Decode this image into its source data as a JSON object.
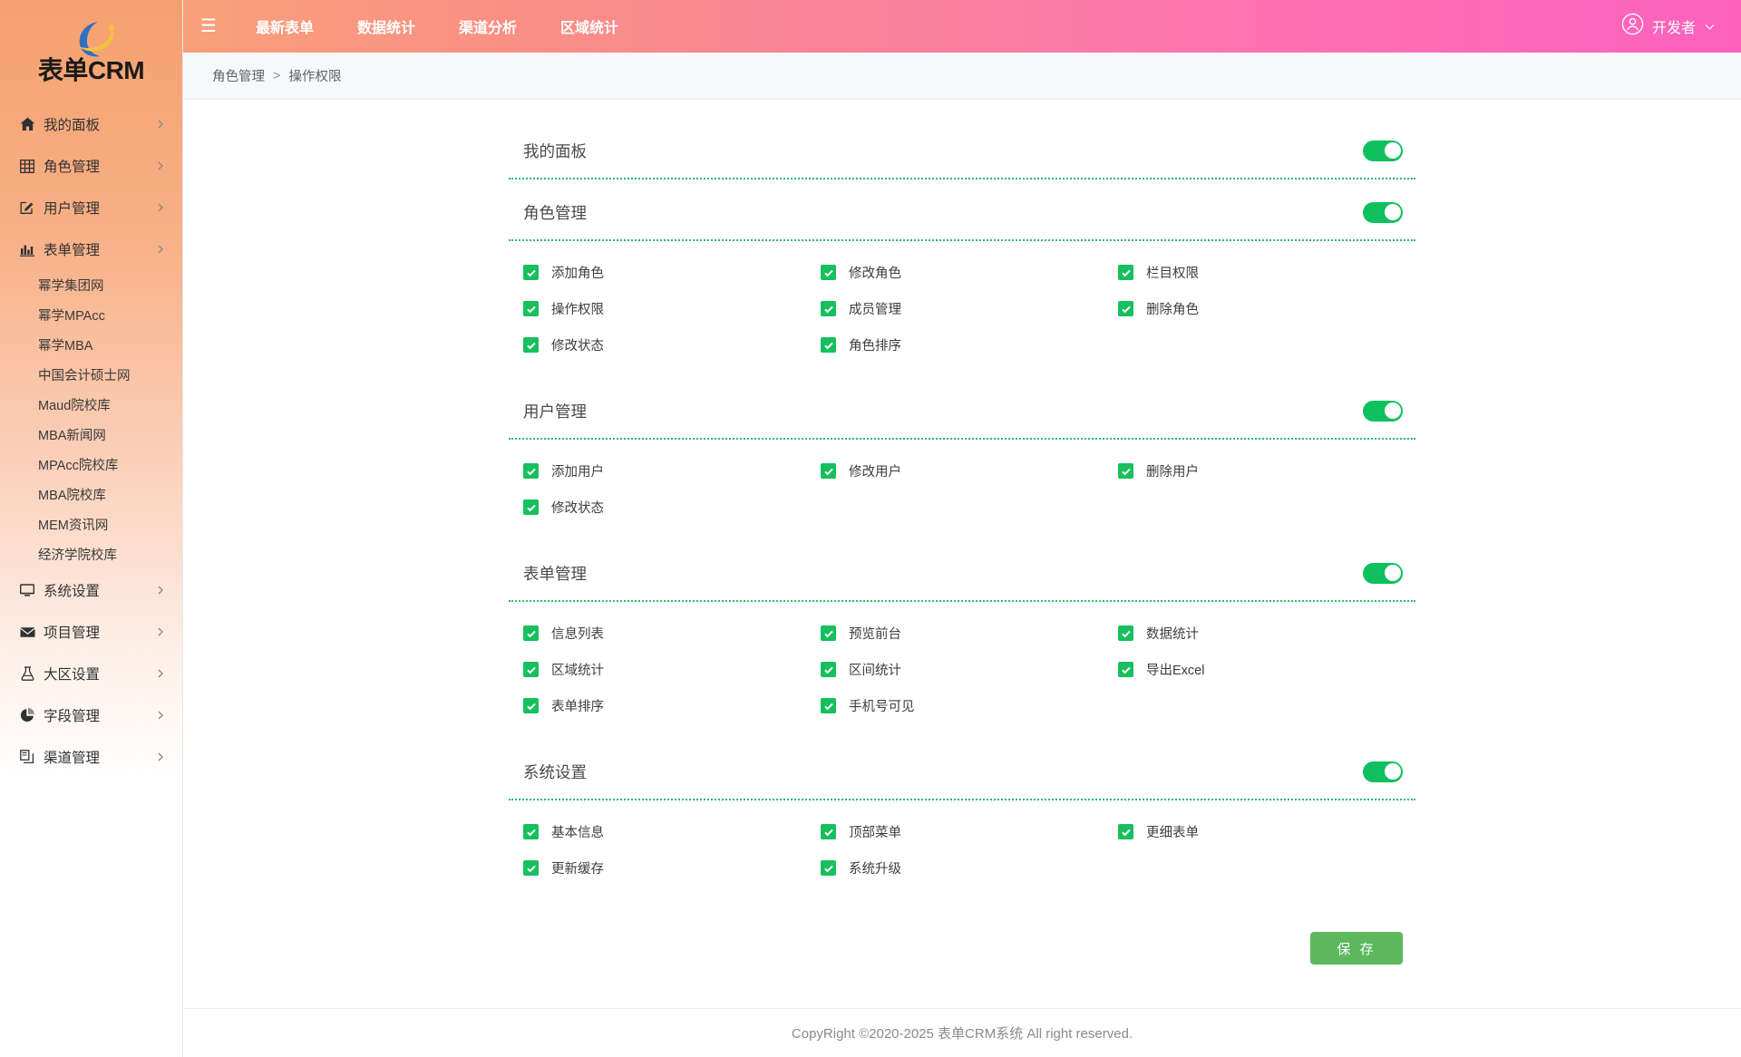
{
  "brand": {
    "name": "表单CRM",
    "logo_icon": "crescent-swoosh-logo",
    "logo_colors": {
      "crescent": "#2f6fc4",
      "swoosh": "#f5c13d"
    },
    "sidebar_gradient_from": "#f5a06e",
    "sidebar_gradient_to": "#ffffff"
  },
  "topbar": {
    "menu_toggle_icon": "hamburger-icon",
    "menu_toggle_label": "☰",
    "gradient_from": "#f8a07a",
    "gradient_to": "#fd61bd",
    "items": [
      {
        "label": "最新表单"
      },
      {
        "label": "数据统计"
      },
      {
        "label": "渠道分析"
      },
      {
        "label": "区域统计"
      }
    ],
    "user": {
      "avatar_icon": "user-circle-icon",
      "name": "开发者",
      "chevron_icon": "chevron-down-icon"
    }
  },
  "breadcrumb": {
    "parent": "角色管理",
    "separator": ">",
    "current": "操作权限"
  },
  "permissions": {
    "accent_on": "#0fc05e",
    "checkbox_color": "#18bf5e",
    "divider_color": "#2fb86b",
    "groups": [
      {
        "title": "我的面板",
        "enabled": true,
        "toggle_state": "on",
        "items": []
      },
      {
        "title": "角色管理",
        "enabled": true,
        "toggle_state": "on",
        "items": [
          {
            "label": "添加角色",
            "checked": true
          },
          {
            "label": "修改角色",
            "checked": true
          },
          {
            "label": "栏目权限",
            "checked": true
          },
          {
            "label": "操作权限",
            "checked": true
          },
          {
            "label": "成员管理",
            "checked": true
          },
          {
            "label": "删除角色",
            "checked": true
          },
          {
            "label": "修改状态",
            "checked": true
          },
          {
            "label": "角色排序",
            "checked": true
          }
        ]
      },
      {
        "title": "用户管理",
        "enabled": true,
        "toggle_state": "on",
        "items": [
          {
            "label": "添加用户",
            "checked": true
          },
          {
            "label": "修改用户",
            "checked": true
          },
          {
            "label": "删除用户",
            "checked": true
          },
          {
            "label": "修改状态",
            "checked": true
          }
        ]
      },
      {
        "title": "表单管理",
        "enabled": true,
        "toggle_state": "on",
        "items": [
          {
            "label": "信息列表",
            "checked": true
          },
          {
            "label": "预览前台",
            "checked": true
          },
          {
            "label": "数据统计",
            "checked": true
          },
          {
            "label": "区域统计",
            "checked": true
          },
          {
            "label": "区间统计",
            "checked": true
          },
          {
            "label": "导出Excel",
            "checked": true
          },
          {
            "label": "表单排序",
            "checked": true
          },
          {
            "label": "手机号可见",
            "checked": true
          }
        ]
      },
      {
        "title": "系统设置",
        "enabled": true,
        "toggle_state": "on",
        "items": [
          {
            "label": "基本信息",
            "checked": true
          },
          {
            "label": "顶部菜单",
            "checked": true
          },
          {
            "label": "更细表单",
            "checked": true
          },
          {
            "label": "更新缓存",
            "checked": true
          },
          {
            "label": "系统升级",
            "checked": true
          }
        ]
      }
    ]
  },
  "actions": {
    "save_label": "保 存",
    "save_color": "#5cb85c"
  },
  "sidebar": {
    "items": [
      {
        "label": "我的面板",
        "icon": "home-icon",
        "type": "parent",
        "expandable": true
      },
      {
        "label": "角色管理",
        "icon": "grid-table-icon",
        "type": "parent",
        "expandable": true
      },
      {
        "label": "用户管理",
        "icon": "edit-square-icon",
        "type": "parent",
        "expandable": true
      },
      {
        "label": "表单管理",
        "icon": "bar-chart-icon",
        "type": "parent",
        "expandable": true
      },
      {
        "label": "幂学集团网",
        "type": "child"
      },
      {
        "label": "幂学MPAcc",
        "type": "child"
      },
      {
        "label": "幂学MBA",
        "type": "child"
      },
      {
        "label": "中国会计硕士网",
        "type": "child"
      },
      {
        "label": "Maud院校库",
        "type": "child"
      },
      {
        "label": "MBA新闻网",
        "type": "child"
      },
      {
        "label": "MPAcc院校库",
        "type": "child"
      },
      {
        "label": "MBA院校库",
        "type": "child"
      },
      {
        "label": "MEM资讯网",
        "type": "child"
      },
      {
        "label": "经济学院校库",
        "type": "child"
      },
      {
        "label": "系统设置",
        "icon": "monitor-icon",
        "type": "parent",
        "expandable": true
      },
      {
        "label": "项目管理",
        "icon": "envelope-icon",
        "type": "parent",
        "expandable": true
      },
      {
        "label": "大区设置",
        "icon": "flask-icon",
        "type": "parent",
        "expandable": true
      },
      {
        "label": "字段管理",
        "icon": "pie-chart-icon",
        "type": "parent",
        "expandable": true
      },
      {
        "label": "渠道管理",
        "icon": "copy-files-icon",
        "type": "parent",
        "expandable": true
      }
    ]
  },
  "footer": {
    "text": "CopyRight ©2020-2025 表单CRM系统 All right reserved."
  }
}
